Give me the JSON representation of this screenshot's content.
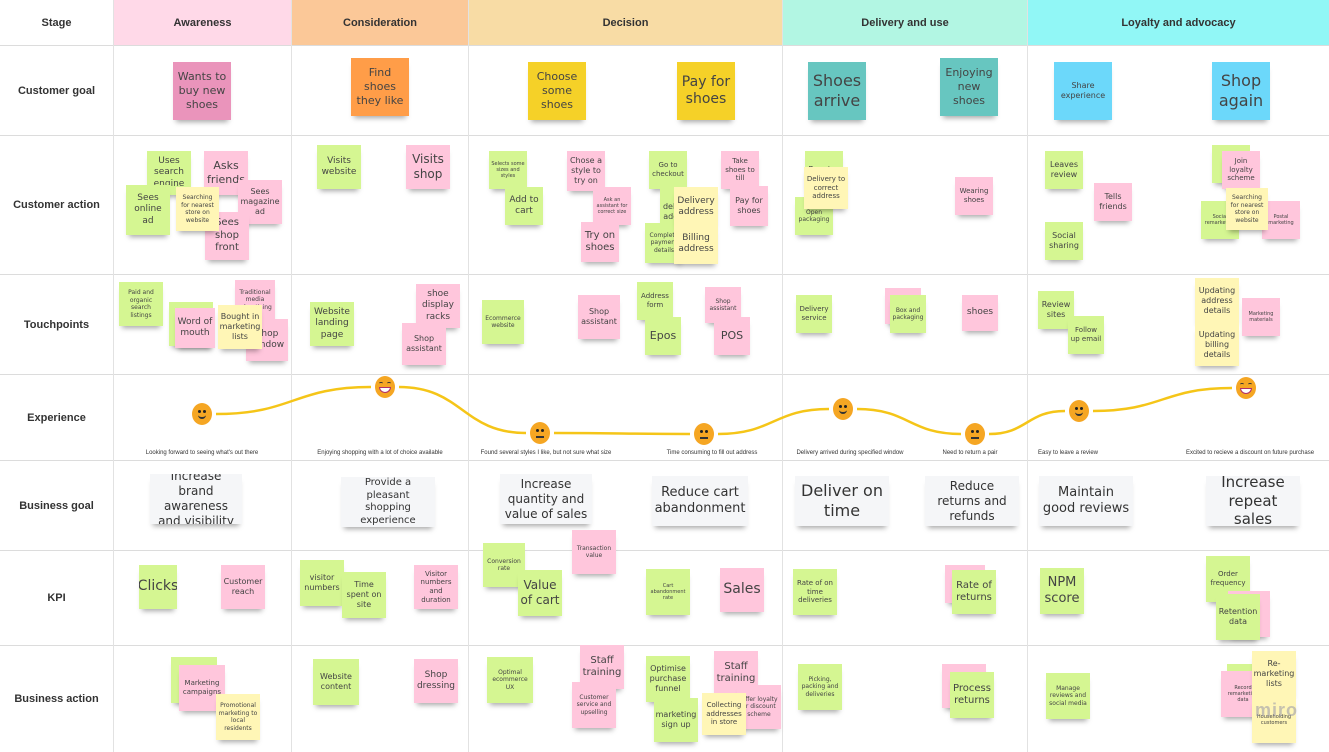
{
  "board": {
    "stage_label": "Stage",
    "stages": [
      {
        "name": "Awareness",
        "color": "#ffd9e8"
      },
      {
        "name": "Consideration",
        "color": "#fbc898"
      },
      {
        "name": "Decision",
        "color": "#f8dca5"
      },
      {
        "name": "Delivery and use",
        "color": "#b2f6e3"
      },
      {
        "name": "Loyalty and advocacy",
        "color": "#91f7f6"
      }
    ],
    "rows": [
      "Customer goal",
      "Customer action",
      "Touchpoints",
      "Experience",
      "Business goal",
      "KPI",
      "Business action"
    ],
    "watermark": "miro"
  },
  "customer_goal": [
    {
      "text": "Wants to buy new shoes",
      "color": "magenta"
    },
    {
      "text": "Find shoes they like",
      "color": "orange"
    },
    {
      "text": "Choose some shoes",
      "color": "gold"
    },
    {
      "text": "Pay for shoes",
      "color": "gold"
    },
    {
      "text": "Shoes arrive",
      "color": "teal"
    },
    {
      "text": "Enjoying new shoes",
      "color": "teal"
    },
    {
      "text": "Share experience",
      "color": "cyan"
    },
    {
      "text": "Shop again",
      "color": "cyan"
    }
  ],
  "customer_action": [
    {
      "text": "Uses search engine",
      "color": "green"
    },
    {
      "text": "Asks friends",
      "color": "pink"
    },
    {
      "text": "Sees online ad",
      "color": "green"
    },
    {
      "text": "Searching for nearest store on website",
      "color": "yellow"
    },
    {
      "text": "Sees magazine ad",
      "color": "pink"
    },
    {
      "text": "Sees shop front",
      "color": "pink"
    },
    {
      "text": "Visits website",
      "color": "green"
    },
    {
      "text": "Visits shop",
      "color": "pink"
    },
    {
      "text": "Selects some sizes and styles",
      "color": "green"
    },
    {
      "text": "Add to cart",
      "color": "green"
    },
    {
      "text": "Chose a style to try on",
      "color": "pink"
    },
    {
      "text": "Ask an assistant for correct size",
      "color": "pink"
    },
    {
      "text": "Try on shoes",
      "color": "pink"
    },
    {
      "text": "Go to checkout",
      "color": "green"
    },
    {
      "text": "Fill delivery address",
      "color": "green"
    },
    {
      "text": "Complete payment details",
      "color": "green"
    },
    {
      "text": "Delivery address",
      "color": "yellow"
    },
    {
      "text": "Billing address",
      "color": "yellow"
    },
    {
      "text": "Take shoes to till",
      "color": "pink"
    },
    {
      "text": "Pay for shoes",
      "color": "pink"
    },
    {
      "text": "Receive",
      "color": "green"
    },
    {
      "text": "Open packaging",
      "color": "green"
    },
    {
      "text": "Delivery to correct address",
      "color": "yellow"
    },
    {
      "text": "Wearing shoes",
      "color": "pink"
    },
    {
      "text": "Leaves review",
      "color": "green"
    },
    {
      "text": "Tells friends",
      "color": "pink"
    },
    {
      "text": "Social sharing",
      "color": "green"
    },
    {
      "text": "",
      "color": "green"
    },
    {
      "text": "Join loyalty scheme",
      "color": "pink"
    },
    {
      "text": "Social remarketing",
      "color": "green"
    },
    {
      "text": "Postal marketing",
      "color": "pink"
    },
    {
      "text": "Searching for nearest store on website",
      "color": "yellow"
    }
  ],
  "touchpoints": [
    {
      "text": "Paid and organic search listings",
      "color": "green"
    },
    {
      "text": "",
      "color": "green"
    },
    {
      "text": "Traditional media advertising",
      "color": "pink"
    },
    {
      "text": "Shop window",
      "color": "pink"
    },
    {
      "text": "Word of mouth",
      "color": "pink"
    },
    {
      "text": "Bought in marketing lists",
      "color": "yellow"
    },
    {
      "text": "Website landing page",
      "color": "green"
    },
    {
      "text": "shoe display racks",
      "color": "pink"
    },
    {
      "text": "Shop assistant",
      "color": "pink"
    },
    {
      "text": "Ecommerce website",
      "color": "green"
    },
    {
      "text": "Shop assistant",
      "color": "pink"
    },
    {
      "text": "Address form",
      "color": "green"
    },
    {
      "text": "Epos",
      "color": "green"
    },
    {
      "text": "Shop assistant",
      "color": "pink"
    },
    {
      "text": "POS",
      "color": "pink"
    },
    {
      "text": "Delivery service",
      "color": "green"
    },
    {
      "text": "",
      "color": "pink"
    },
    {
      "text": "Box and packaging",
      "color": "green"
    },
    {
      "text": "shoes",
      "color": "pink"
    },
    {
      "text": "Review sites",
      "color": "green"
    },
    {
      "text": "Follow up email",
      "color": "green"
    },
    {
      "text": "Updating address details",
      "color": "yellow"
    },
    {
      "text": "Updating billing details",
      "color": "yellow"
    },
    {
      "text": "Marketing materials",
      "color": "pink"
    }
  ],
  "experience": {
    "line_color": "#f5c518",
    "points": [
      {
        "mood": "happy",
        "label": "Looking forward to seeing what's out there"
      },
      {
        "mood": "delighted",
        "label": "Enjoying shopping with a lot of choice available"
      },
      {
        "mood": "neutral",
        "label": "Found several styles I like, but not sure what size"
      },
      {
        "mood": "neutral",
        "label": "Time consuming to fill out address"
      },
      {
        "mood": "happy",
        "label": "Delivery arrived during specified window"
      },
      {
        "mood": "neutral",
        "label": "Need to return a pair"
      },
      {
        "mood": "happy",
        "label": "Easy to leave a review"
      },
      {
        "mood": "delighted",
        "label": "Excited to recieve a discount on future purchase"
      }
    ]
  },
  "business_goal": [
    {
      "text": "Increase brand awareness and visibility",
      "color": "white"
    },
    {
      "text": "Provide a pleasant shopping experience",
      "color": "white"
    },
    {
      "text": "Increase quantity and value of sales",
      "color": "white"
    },
    {
      "text": "Reduce cart abandonment",
      "color": "white"
    },
    {
      "text": "Deliver on time",
      "color": "white"
    },
    {
      "text": "Reduce returns and refunds",
      "color": "white"
    },
    {
      "text": "Maintain good reviews",
      "color": "white"
    },
    {
      "text": "Increase repeat sales",
      "color": "white"
    }
  ],
  "kpi": [
    {
      "text": "Clicks",
      "color": "green"
    },
    {
      "text": "Customer reach",
      "color": "pink"
    },
    {
      "text": "visitor numbers",
      "color": "green"
    },
    {
      "text": "Time spent on site",
      "color": "green"
    },
    {
      "text": "Visitor numbers and duration",
      "color": "pink"
    },
    {
      "text": "Conversion rate",
      "color": "green"
    },
    {
      "text": "Transaction value",
      "color": "pink"
    },
    {
      "text": "Value of cart",
      "color": "green"
    },
    {
      "text": "Cart abandonment rate",
      "color": "green"
    },
    {
      "text": "Sales",
      "color": "pink"
    },
    {
      "text": "Rate of on time deliveries",
      "color": "green"
    },
    {
      "text": "",
      "color": "pink"
    },
    {
      "text": "Rate of returns",
      "color": "green"
    },
    {
      "text": "NPM score",
      "color": "green"
    },
    {
      "text": "Order frequency",
      "color": "green"
    },
    {
      "text": "",
      "color": "pink"
    },
    {
      "text": "Retention data",
      "color": "green"
    }
  ],
  "business_action": [
    {
      "text": "",
      "color": "green"
    },
    {
      "text": "Marketing campaigns",
      "color": "pink"
    },
    {
      "text": "Promotional marketing to local residents",
      "color": "yellow"
    },
    {
      "text": "Website content",
      "color": "green"
    },
    {
      "text": "Shop dressing",
      "color": "pink"
    },
    {
      "text": "Optimal ecommerce UX",
      "color": "green"
    },
    {
      "text": "Staff training",
      "color": "pink"
    },
    {
      "text": "Customer service and upselling",
      "color": "pink"
    },
    {
      "text": "Optimise purchase funnel",
      "color": "green"
    },
    {
      "text": "marketing sign up",
      "color": "green"
    },
    {
      "text": "Staff training",
      "color": "pink"
    },
    {
      "text": "Offer loyalty or discount scheme",
      "color": "pink"
    },
    {
      "text": "Collecting addresses in store",
      "color": "yellow"
    },
    {
      "text": "Picking, packing and deliveries",
      "color": "green"
    },
    {
      "text": "",
      "color": "pink"
    },
    {
      "text": "Process returns",
      "color": "green"
    },
    {
      "text": "Manage reviews and social media",
      "color": "green"
    },
    {
      "text": "",
      "color": "green"
    },
    {
      "text": "Record remarketing data",
      "color": "pink"
    },
    {
      "text": "Re-marketing lists",
      "color": "yellow"
    },
    {
      "text": "Householding customers",
      "color": "yellow"
    }
  ]
}
